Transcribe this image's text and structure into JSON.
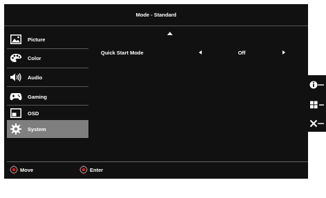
{
  "header": {
    "title": "Mode - Standard"
  },
  "menu": {
    "items": [
      {
        "label": "Picture",
        "icon": "picture-icon",
        "active": false
      },
      {
        "label": "Color",
        "icon": "palette-icon",
        "active": false
      },
      {
        "label": "Audio",
        "icon": "speaker-icon",
        "active": false
      },
      {
        "label": "Gaming",
        "icon": "gamepad-icon",
        "active": false
      },
      {
        "label": "OSD",
        "icon": "osd-window-icon",
        "active": false
      },
      {
        "label": "System",
        "icon": "gear-icon",
        "active": true
      }
    ]
  },
  "settings": [
    {
      "label": "Quick Start Mode",
      "value": "Off"
    }
  ],
  "footer": {
    "move_label": "Move",
    "enter_label": "Enter"
  },
  "side_panel": {
    "buttons": [
      "info-icon",
      "grid-icon",
      "close-icon"
    ]
  },
  "colors": {
    "background": "#111111",
    "active_item": "#7f7f7f",
    "dpad_accent": "#e02020",
    "text": "#ffffff"
  }
}
